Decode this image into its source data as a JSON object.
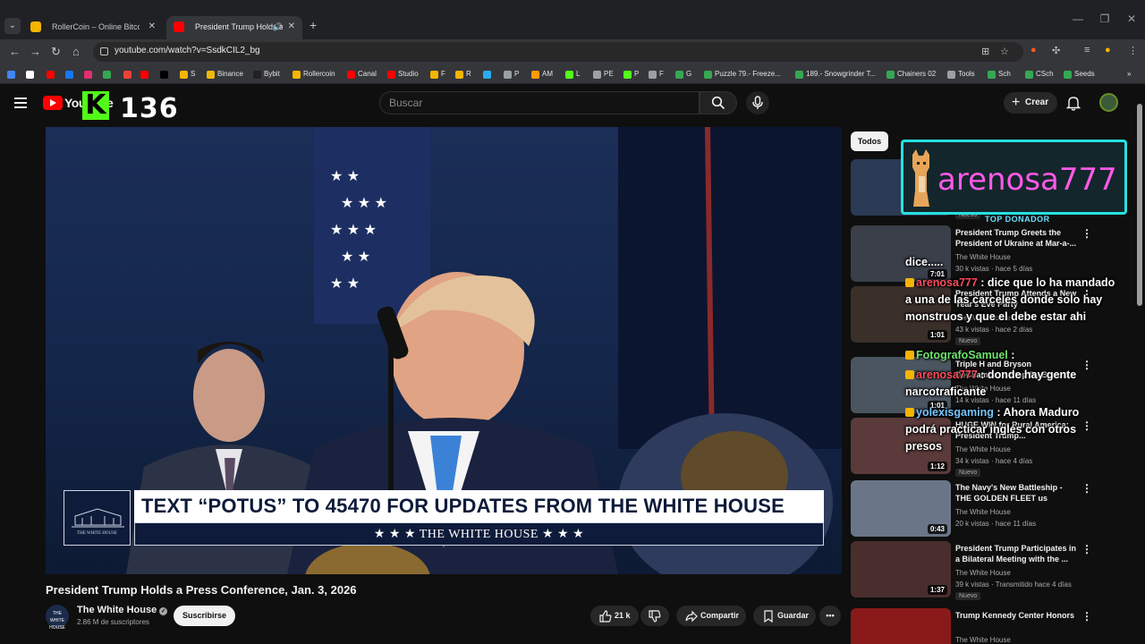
{
  "browser": {
    "tabs": [
      {
        "title": "RollerCoin – Online Bitcoin Mining Game",
        "active": false
      },
      {
        "title": "President Trump Holds a Press Conference",
        "active": true
      }
    ],
    "url": "youtube.com/watch?v=SsdkCIL2_bg",
    "bookmarks": [
      {
        "label": "",
        "color": "#4285f4"
      },
      {
        "label": "",
        "color": "#ffffff"
      },
      {
        "label": "",
        "color": "#ff0000"
      },
      {
        "label": "",
        "color": "#1877f2"
      },
      {
        "label": "",
        "color": "#e1306c"
      },
      {
        "label": "",
        "color": "#34a853"
      },
      {
        "label": "",
        "color": "#ea4335"
      },
      {
        "label": "",
        "color": "#ff0000"
      },
      {
        "label": "",
        "color": "#000000"
      },
      {
        "label": "S",
        "color": "#f4b400"
      },
      {
        "label": "Binance",
        "color": "#f0b90b"
      },
      {
        "label": "Bybit",
        "color": "#222222"
      },
      {
        "label": "Rollercoin",
        "color": "#f4b400"
      },
      {
        "label": "Canal",
        "color": "#ff0000"
      },
      {
        "label": "Studio",
        "color": "#ff0000"
      },
      {
        "label": "F",
        "color": "#f4b400"
      },
      {
        "label": "R",
        "color": "#f4b400"
      },
      {
        "label": "",
        "color": "#2aabee"
      },
      {
        "label": "P",
        "color": "#9aa0a6"
      },
      {
        "label": "AM",
        "color": "#ff9900"
      },
      {
        "label": "L",
        "color": "#53fc18"
      },
      {
        "label": "PE",
        "color": "#9aa0a6"
      },
      {
        "label": "P",
        "color": "#53fc18"
      },
      {
        "label": "F",
        "color": "#9aa0a6"
      },
      {
        "label": "G",
        "color": "#34a853"
      },
      {
        "label": "Puzzle 79.- Freeze...",
        "color": "#34a853"
      },
      {
        "label": "189.- Snowgrinder T...",
        "color": "#34a853"
      },
      {
        "label": "Chainers 02",
        "color": "#34a853"
      },
      {
        "label": "Tools",
        "color": "#9aa0a6"
      },
      {
        "label": "Sch",
        "color": "#34a853"
      },
      {
        "label": "CSch",
        "color": "#34a853"
      },
      {
        "label": "Seeds",
        "color": "#34a853"
      }
    ]
  },
  "youtube": {
    "logo_text": "YouTube",
    "search_placeholder": "Buscar",
    "create_label": "Crear"
  },
  "overlay": {
    "kick_letter": "K",
    "kick_viewers": "136",
    "donor_name": "arenosa777",
    "donor_label": "TOP DONADOR",
    "chat": [
      {
        "user": "",
        "text": "dice.....",
        "user_color": "red"
      },
      {
        "user": "arenosa777",
        "text": ": dice que lo ha mandado a una de las carceles donde solo hay monstruos y que el debe estar ahi",
        "user_color": "red"
      },
      {
        "user": "FotografoSamuel",
        "text": ":",
        "user_color": "green"
      },
      {
        "user": "arenosa777",
        "text": ": donde hay gente narcotraficante",
        "user_color": "red"
      },
      {
        "user": "yolexisgaming",
        "text": ": Ahora Maduro podrá practicar inglés con otros presos",
        "user_color": "blue"
      }
    ]
  },
  "video": {
    "lower_third_main": "TEXT “POTUS” TO 45470 FOR UPDATES FROM THE WHITE HOUSE",
    "lower_third_sub": "★ ★ ★   THE WHITE HOUSE   ★ ★ ★",
    "logo_text": "THE WHITE HOUSE",
    "title": "President Trump Holds a Press Conference, Jan. 3, 2026",
    "channel": "The White House",
    "subscribers": "2.86 M de suscriptores",
    "subscribe_label": "Suscribirse",
    "likes": "21 k",
    "share_label": "Compartir",
    "save_label": "Guardar"
  },
  "sidebar": {
    "chip_all": "Todos",
    "recommendations": [
      {
        "title": "",
        "channel": "",
        "meta": "",
        "duration": "",
        "new": "Nuevo"
      },
      {
        "title": "President Trump Greets the President of Ukraine at Mar-a-...",
        "channel": "The White House",
        "meta": "30 k vistas · hace 5 días",
        "duration": "7:01",
        "new": ""
      },
      {
        "title": "President Trump Attends a New Year's Eve Party",
        "channel": "The White House",
        "meta": "43 k vistas · hace 2 días",
        "duration": "1:01",
        "new": "Nuevo"
      },
      {
        "title": "Triple H and Bryson DeChambeau Stop By Burlon...",
        "channel": "The White House",
        "meta": "14 k vistas · hace 11 días",
        "duration": "1:01",
        "new": ""
      },
      {
        "title": "HUGE WIN for Rural America: President Trump...",
        "channel": "The White House",
        "meta": "34 k vistas · hace 4 días",
        "duration": "1:12",
        "new": "Nuevo"
      },
      {
        "title": "The Navy's New Battleship - THE GOLDEN FLEET us",
        "channel": "The White House",
        "meta": "20 k vistas · hace 11 días",
        "duration": "0:43",
        "new": ""
      },
      {
        "title": "President Trump Participates in a Bilateral Meeting with the ...",
        "channel": "The White House",
        "meta": "39 k vistas · Transmitido hace 4 días",
        "duration": "1:37",
        "new": "Nuevo"
      },
      {
        "title": "Trump Kennedy Center Honors",
        "channel": "The White House",
        "meta": "",
        "duration": "",
        "new": ""
      }
    ]
  }
}
